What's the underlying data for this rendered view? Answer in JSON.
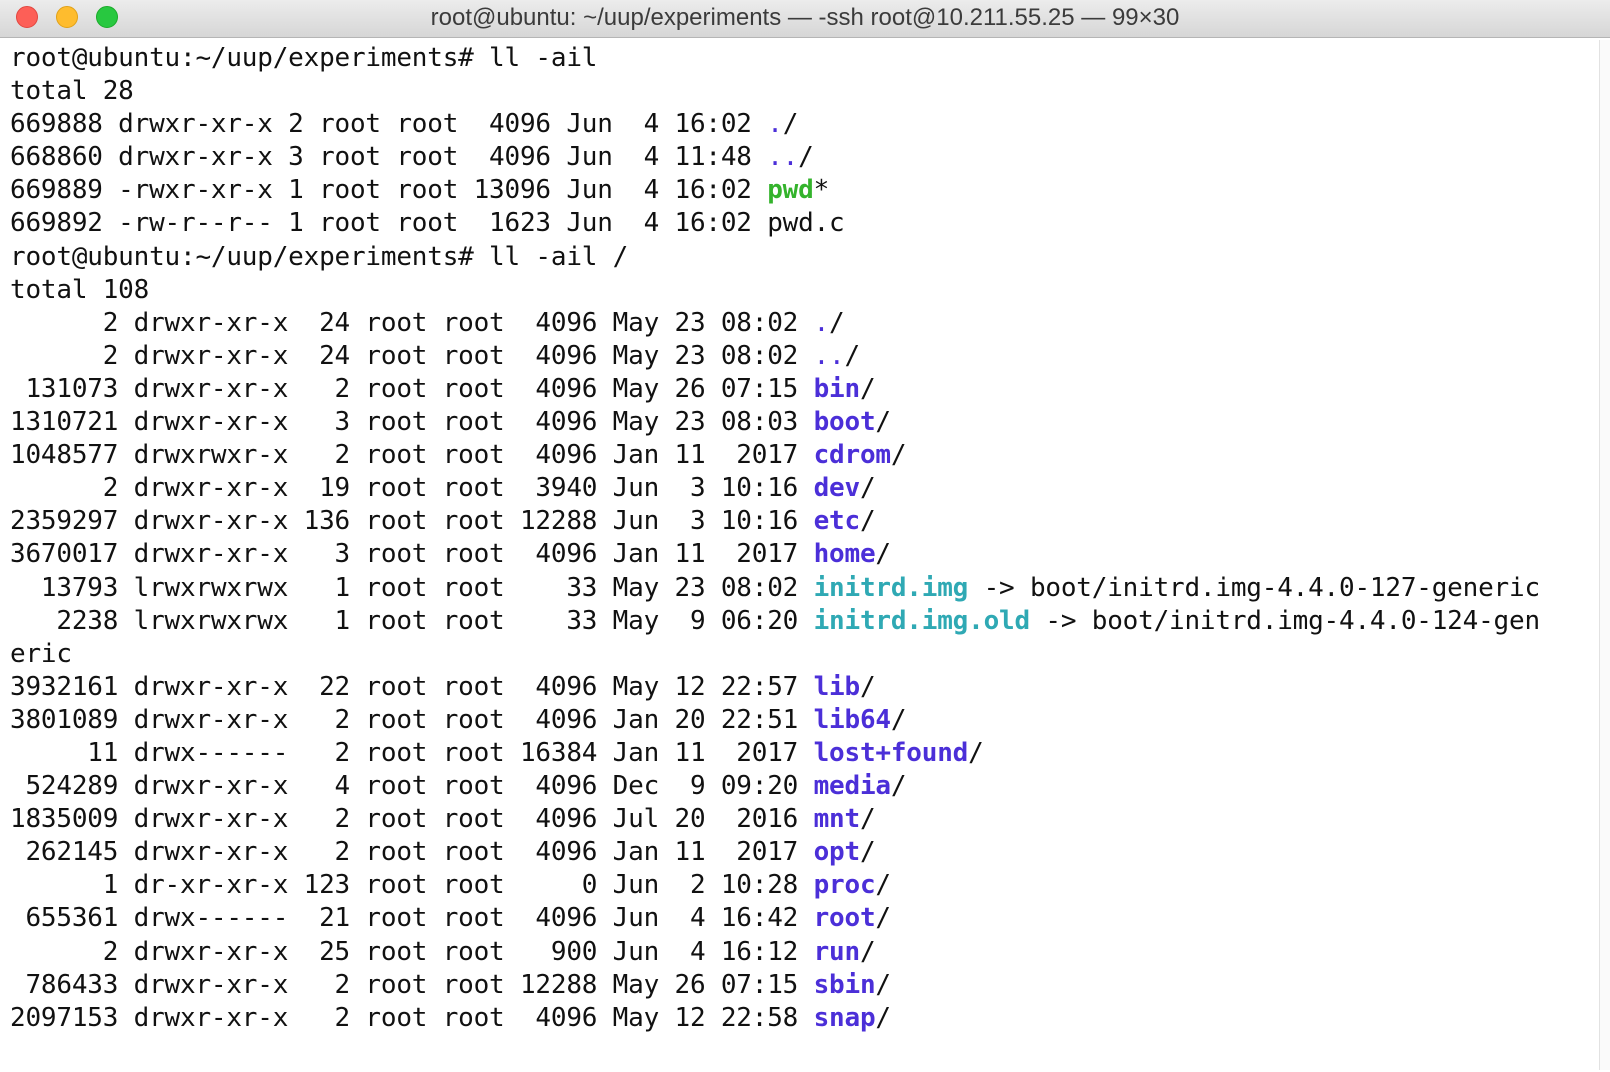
{
  "window": {
    "title": "root@ubuntu: ~/uup/experiments — -ssh root@10.211.55.25 — 99×30"
  },
  "terminal": {
    "lines": [
      {
        "segments": [
          {
            "t": "root@ubuntu:~/uup/experiments# ll -ail",
            "c": ""
          }
        ]
      },
      {
        "segments": [
          {
            "t": "total 28",
            "c": ""
          }
        ]
      },
      {
        "segments": [
          {
            "t": "669888 drwxr-xr-x 2 root root  4096 Jun  4 16:02 ",
            "c": ""
          },
          {
            "t": ".",
            "c": "dot"
          },
          {
            "t": "/",
            "c": ""
          }
        ]
      },
      {
        "segments": [
          {
            "t": "668860 drwxr-xr-x 3 root root  4096 Jun  4 11:48 ",
            "c": ""
          },
          {
            "t": "..",
            "c": "dot"
          },
          {
            "t": "/",
            "c": ""
          }
        ]
      },
      {
        "segments": [
          {
            "t": "669889 -rwxr-xr-x 1 root root 13096 Jun  4 16:02 ",
            "c": ""
          },
          {
            "t": "pwd",
            "c": "exe"
          },
          {
            "t": "*",
            "c": ""
          }
        ]
      },
      {
        "segments": [
          {
            "t": "669892 -rw-r--r-- 1 root root  1623 Jun  4 16:02 pwd.c",
            "c": ""
          }
        ]
      },
      {
        "segments": [
          {
            "t": "root@ubuntu:~/uup/experiments# ll -ail /",
            "c": ""
          }
        ]
      },
      {
        "segments": [
          {
            "t": "total 108",
            "c": ""
          }
        ]
      },
      {
        "segments": [
          {
            "t": "      2 drwxr-xr-x  24 root root  4096 May 23 08:02 ",
            "c": ""
          },
          {
            "t": ".",
            "c": "dot"
          },
          {
            "t": "/",
            "c": ""
          }
        ]
      },
      {
        "segments": [
          {
            "t": "      2 drwxr-xr-x  24 root root  4096 May 23 08:02 ",
            "c": ""
          },
          {
            "t": "..",
            "c": "dot"
          },
          {
            "t": "/",
            "c": ""
          }
        ]
      },
      {
        "segments": [
          {
            "t": " 131073 drwxr-xr-x   2 root root  4096 May 26 07:15 ",
            "c": ""
          },
          {
            "t": "bin",
            "c": "dir"
          },
          {
            "t": "/",
            "c": ""
          }
        ]
      },
      {
        "segments": [
          {
            "t": "1310721 drwxr-xr-x   3 root root  4096 May 23 08:03 ",
            "c": ""
          },
          {
            "t": "boot",
            "c": "dir"
          },
          {
            "t": "/",
            "c": ""
          }
        ]
      },
      {
        "segments": [
          {
            "t": "1048577 drwxrwxr-x   2 root root  4096 Jan 11  2017 ",
            "c": ""
          },
          {
            "t": "cdrom",
            "c": "dir"
          },
          {
            "t": "/",
            "c": ""
          }
        ]
      },
      {
        "segments": [
          {
            "t": "      2 drwxr-xr-x  19 root root  3940 Jun  3 10:16 ",
            "c": ""
          },
          {
            "t": "dev",
            "c": "dir"
          },
          {
            "t": "/",
            "c": ""
          }
        ]
      },
      {
        "segments": [
          {
            "t": "2359297 drwxr-xr-x 136 root root 12288 Jun  3 10:16 ",
            "c": ""
          },
          {
            "t": "etc",
            "c": "dir"
          },
          {
            "t": "/",
            "c": ""
          }
        ]
      },
      {
        "segments": [
          {
            "t": "3670017 drwxr-xr-x   3 root root  4096 Jan 11  2017 ",
            "c": ""
          },
          {
            "t": "home",
            "c": "dir"
          },
          {
            "t": "/",
            "c": ""
          }
        ]
      },
      {
        "segments": [
          {
            "t": "  13793 lrwxrwxrwx   1 root root    33 May 23 08:02 ",
            "c": ""
          },
          {
            "t": "initrd.img",
            "c": "lnk"
          },
          {
            "t": " -> boot/initrd.img-4.4.0-127-generic",
            "c": ""
          }
        ]
      },
      {
        "segments": [
          {
            "t": "   2238 lrwxrwxrwx   1 root root    33 May  9 06:20 ",
            "c": ""
          },
          {
            "t": "initrd.img.old",
            "c": "lnk"
          },
          {
            "t": " -> boot/initrd.img-4.4.0-124-gen",
            "c": ""
          }
        ]
      },
      {
        "segments": [
          {
            "t": "eric",
            "c": ""
          }
        ]
      },
      {
        "segments": [
          {
            "t": "3932161 drwxr-xr-x  22 root root  4096 May 12 22:57 ",
            "c": ""
          },
          {
            "t": "lib",
            "c": "dir"
          },
          {
            "t": "/",
            "c": ""
          }
        ]
      },
      {
        "segments": [
          {
            "t": "3801089 drwxr-xr-x   2 root root  4096 Jan 20 22:51 ",
            "c": ""
          },
          {
            "t": "lib64",
            "c": "dir"
          },
          {
            "t": "/",
            "c": ""
          }
        ]
      },
      {
        "segments": [
          {
            "t": "     11 drwx------   2 root root 16384 Jan 11  2017 ",
            "c": ""
          },
          {
            "t": "lost+found",
            "c": "dir"
          },
          {
            "t": "/",
            "c": ""
          }
        ]
      },
      {
        "segments": [
          {
            "t": " 524289 drwxr-xr-x   4 root root  4096 Dec  9 09:20 ",
            "c": ""
          },
          {
            "t": "media",
            "c": "dir"
          },
          {
            "t": "/",
            "c": ""
          }
        ]
      },
      {
        "segments": [
          {
            "t": "1835009 drwxr-xr-x   2 root root  4096 Jul 20  2016 ",
            "c": ""
          },
          {
            "t": "mnt",
            "c": "dir"
          },
          {
            "t": "/",
            "c": ""
          }
        ]
      },
      {
        "segments": [
          {
            "t": " 262145 drwxr-xr-x   2 root root  4096 Jan 11  2017 ",
            "c": ""
          },
          {
            "t": "opt",
            "c": "dir"
          },
          {
            "t": "/",
            "c": ""
          }
        ]
      },
      {
        "segments": [
          {
            "t": "      1 dr-xr-xr-x 123 root root     0 Jun  2 10:28 ",
            "c": ""
          },
          {
            "t": "proc",
            "c": "dir"
          },
          {
            "t": "/",
            "c": ""
          }
        ]
      },
      {
        "segments": [
          {
            "t": " 655361 drwx------  21 root root  4096 Jun  4 16:42 ",
            "c": ""
          },
          {
            "t": "root",
            "c": "dir"
          },
          {
            "t": "/",
            "c": ""
          }
        ]
      },
      {
        "segments": [
          {
            "t": "      2 drwxr-xr-x  25 root root   900 Jun  4 16:12 ",
            "c": ""
          },
          {
            "t": "run",
            "c": "dir"
          },
          {
            "t": "/",
            "c": ""
          }
        ]
      },
      {
        "segments": [
          {
            "t": " 786433 drwxr-xr-x   2 root root 12288 May 26 07:15 ",
            "c": ""
          },
          {
            "t": "sbin",
            "c": "dir"
          },
          {
            "t": "/",
            "c": ""
          }
        ]
      },
      {
        "segments": [
          {
            "t": "2097153 drwxr-xr-x   2 root root  4096 May 12 22:58 ",
            "c": ""
          },
          {
            "t": "snap",
            "c": "dir"
          },
          {
            "t": "/",
            "c": ""
          }
        ]
      }
    ]
  },
  "colors": {
    "directory": "#4b2fd8",
    "symlink": "#2fa9b4",
    "executable": "#34b32c",
    "text": "#111111"
  },
  "icons": {
    "close": "close-icon",
    "minimize": "minimize-icon",
    "zoom": "zoom-icon"
  }
}
